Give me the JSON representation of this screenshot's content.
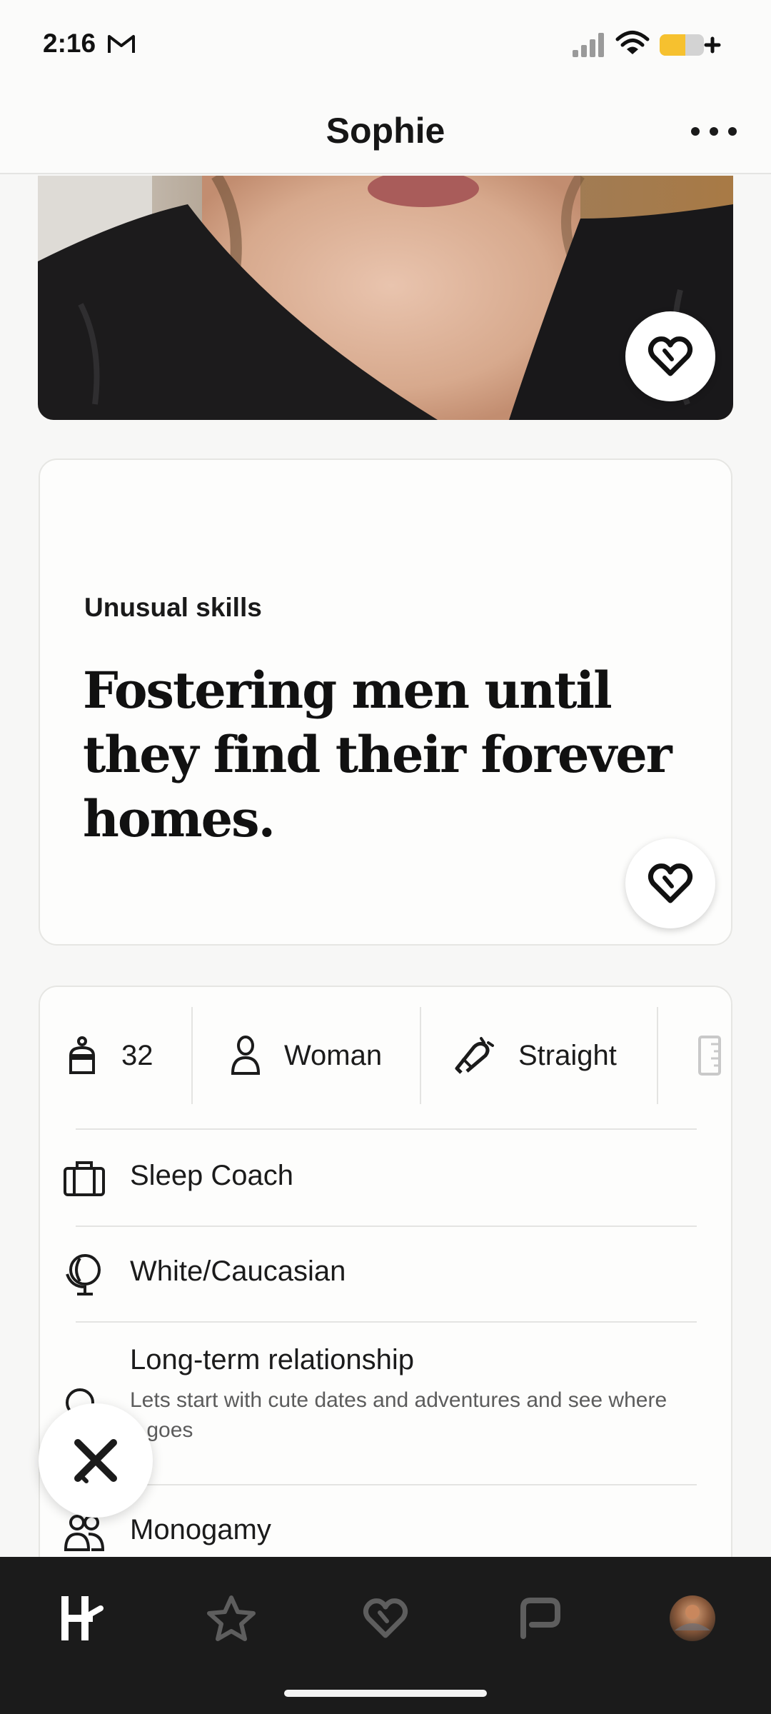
{
  "status_bar": {
    "time": "2:16",
    "icons": [
      "gmail-icon",
      "signal-icon",
      "wifi-icon",
      "battery-icon"
    ],
    "battery_color": "#f6c12f"
  },
  "header": {
    "title": "Sophie",
    "more_icon": "more-horizontal-icon"
  },
  "photo": {
    "like_icon": "heart-icon"
  },
  "prompt": {
    "question": "Unusual skills",
    "answer": "Fostering men until they find their forever homes.",
    "like_icon": "heart-icon"
  },
  "vitals": {
    "age": "32",
    "gender": "Woman",
    "sexuality": "Straight",
    "job": "Sleep Coach",
    "ethnicity": "White/Caucasian",
    "intention": "Long-term relationship",
    "intention_note": "Lets start with cute dates and adventures and see where it goes",
    "relationship_type": "Monogamy"
  },
  "dismiss": {
    "icon": "close-icon"
  },
  "bottom_nav": {
    "items": [
      "home-icon",
      "star-icon",
      "heart-icon",
      "chat-icon",
      "profile-avatar"
    ],
    "active": "home-icon"
  }
}
